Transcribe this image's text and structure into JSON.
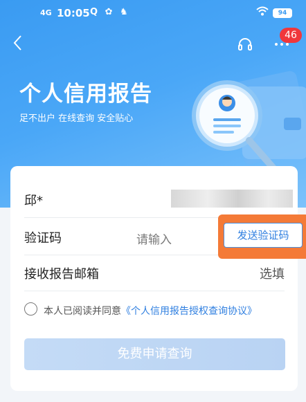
{
  "status_bar": {
    "signal": "4G",
    "time": "10:05",
    "icons": "Q ✿ ♞",
    "battery": "94"
  },
  "header": {
    "badge_count": "46",
    "title": "个人信用报告",
    "subtitle": "足不出户 在线查询 安全贴心"
  },
  "form": {
    "name_label": "邱*",
    "code_label": "验证码",
    "code_placeholder": "请输入",
    "send_code_label": "发送验证码",
    "email_label": "接收报告邮箱",
    "email_placeholder": "选填",
    "agree_text": "本人已阅读并同意",
    "agree_link": "《个人信用报告授权查询协议》",
    "submit_label": "免费申请查询"
  },
  "colors": {
    "accent": "#2f7fe0",
    "highlight": "#f47a37",
    "badge": "#f0373c"
  }
}
